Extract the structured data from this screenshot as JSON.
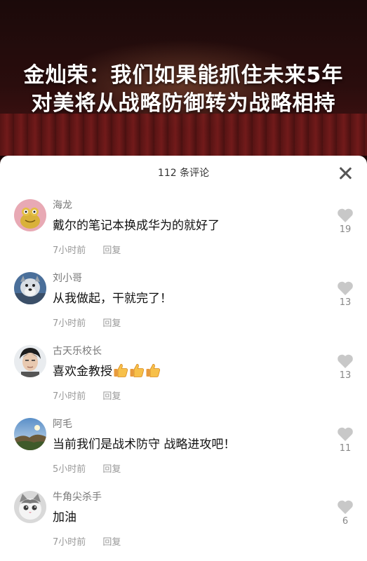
{
  "video": {
    "title_line1": "金灿荣：我们如果能抓住未来5年",
    "title_line2": "对美将从战略防御转为战略相持"
  },
  "comments_panel": {
    "count_label": "112 条评论",
    "reply_label": "回复",
    "comments": [
      {
        "user": "海龙",
        "text": "戴尔的笔记本换成华为的就好了",
        "time": "7小时前",
        "likes": "19",
        "avatar_icon": "cartoon-frog-avatar"
      },
      {
        "user": "刘小哥",
        "text": "从我做起，干就完了！",
        "time": "7小时前",
        "likes": "13",
        "avatar_icon": "cartoon-dog-avatar"
      },
      {
        "user": "古天乐校长",
        "text": "喜欢金教授",
        "time": "7小时前",
        "likes": "13",
        "avatar_icon": "man-portrait-avatar",
        "emojis": [
          "thumbs-up-icon",
          "thumbs-up-icon",
          "thumbs-up-icon"
        ]
      },
      {
        "user": "阿毛",
        "text": "当前我们是战术防守 战略进攻吧！",
        "time": "5小时前",
        "likes": "11",
        "avatar_icon": "landscape-avatar"
      },
      {
        "user": "牛角尖杀手",
        "text": "加油",
        "time": "7小时前",
        "likes": "6",
        "avatar_icon": "cat-avatar"
      }
    ]
  },
  "colors": {
    "sheet_bg": "#ffffff",
    "like_icon": "#c8c8c8",
    "muted_text": "#999999"
  }
}
